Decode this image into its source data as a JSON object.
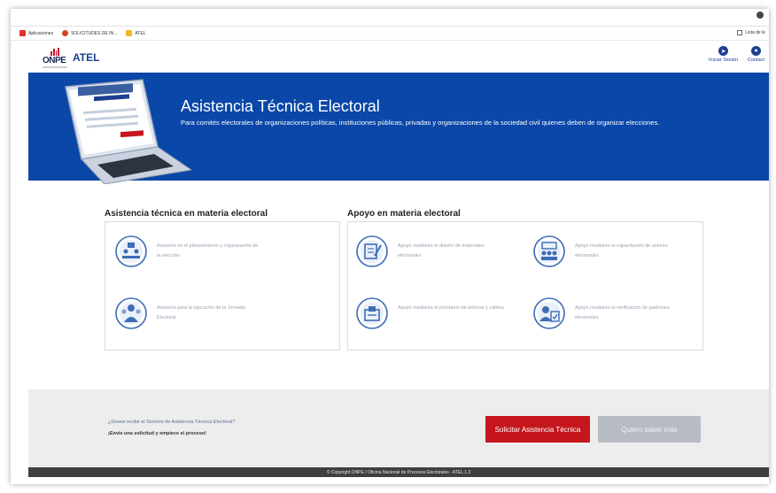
{
  "browser": {
    "bookmarks": [
      {
        "label": "Aplicaciones",
        "color": "#e0312c"
      },
      {
        "label": "SOLICITUDES DE IN...",
        "color": "#d4451f"
      },
      {
        "label": "ATEL",
        "color": "#f2b824"
      }
    ],
    "reading_list": "Lista de le"
  },
  "header": {
    "logo_text": "ONPE",
    "brand": "ATEL",
    "login_label": "Iniciar Sesión",
    "contact_label": "Contact"
  },
  "banner": {
    "title": "Asistencia Técnica Electoral",
    "subtitle": "Para comités electorales de organizaciones políticas, instituciones públicas, privadas y organizaciones de la sociedad civil quienes deben de organizar elecciones.",
    "laptop_screen_title": "Trámite / Servicio"
  },
  "sections": {
    "technical": {
      "title": "Asistencia técnica en materia electoral",
      "items": [
        {
          "text": "Asesoría en el planeamiento y organización de la elección",
          "icon": "planning-meeting-icon"
        },
        {
          "text": "Asesoría para la ejecución de la Jornada Electoral",
          "icon": "election-staff-icon"
        }
      ]
    },
    "support": {
      "title": "Apoyo en materia electoral",
      "items": [
        {
          "text": "Apoyo mediante el diseño de materiales electorales",
          "icon": "design-materials-icon"
        },
        {
          "text": "Apoyo mediante la capacitación de actores electorales",
          "icon": "training-actors-icon"
        },
        {
          "text": "Apoyo mediante el préstamo de ánforas y cabina",
          "icon": "ballot-box-icon"
        },
        {
          "text": "Apoyo mediante la verificación de padrones electorales",
          "icon": "voter-roll-verify-icon"
        }
      ]
    }
  },
  "cta": {
    "question": "¿Desea recibir el Servicio de Asistencia Técnica Electoral?",
    "prompt": "¡Envíe una solicitud y empiece el proceso!",
    "primary_button": "Solicitar Asistencia Técnica",
    "secondary_button": "Quiero saber más"
  },
  "footer": {
    "copyright": "© Copyright ONPE / Oficina Nacional de Procesos Electorales - ATEL 1.3"
  },
  "colors": {
    "brand_blue": "#0a47a8",
    "cta_red": "#c4161c",
    "icon_blue": "#3d6db5"
  }
}
